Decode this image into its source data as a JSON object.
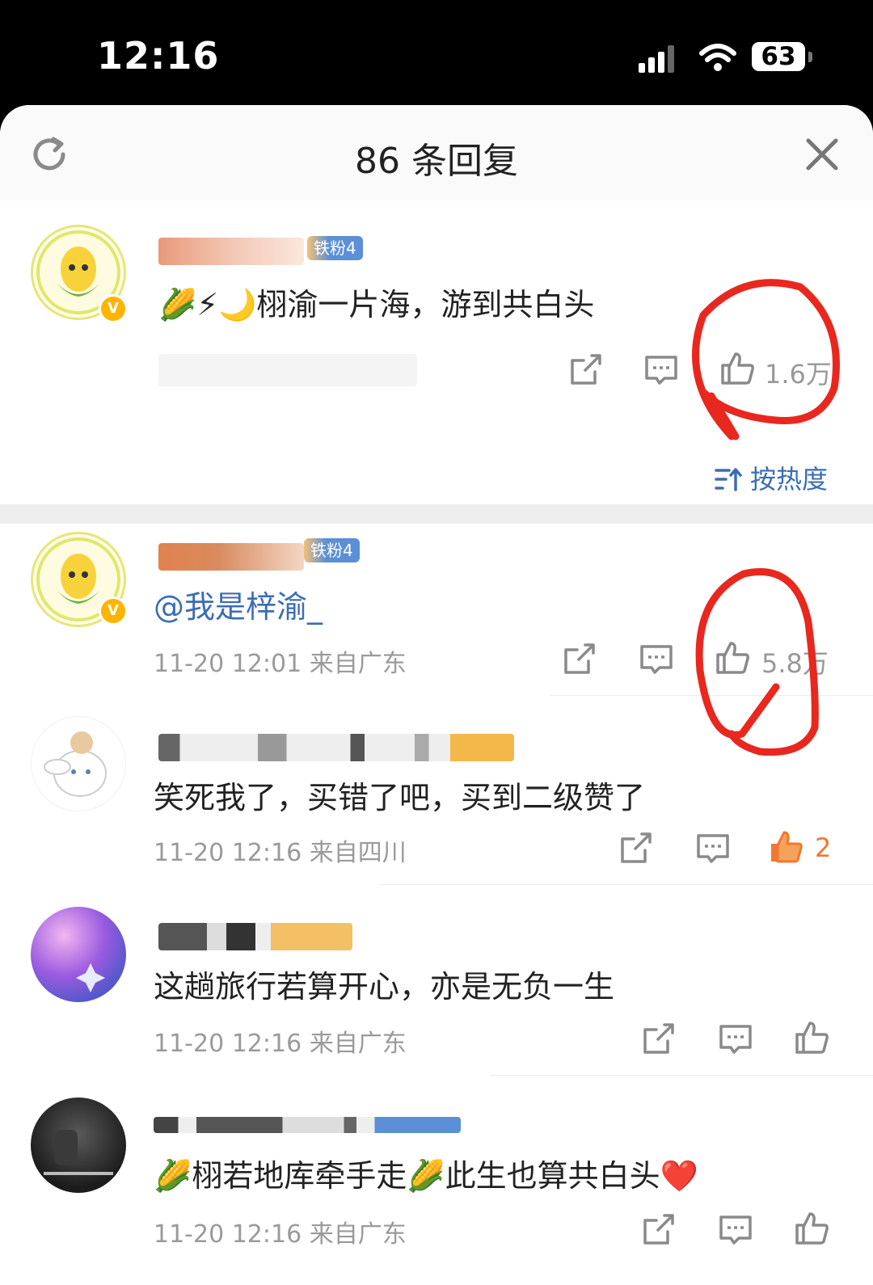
{
  "status_bar": {
    "time": "12:16",
    "battery": "63"
  },
  "header": {
    "title": "86 条回复"
  },
  "root": {
    "badge": "铁粉4",
    "text_emoji": "🌽⚡🌙",
    "text": "栩渝一片海，游到共白头",
    "likes": "1.6万"
  },
  "sort": {
    "label": "按热度"
  },
  "replies": [
    {
      "badge": "铁粉4",
      "text": "@我是梓渝_",
      "meta": "11-20 12:01 来自广东",
      "likes": "5.8万"
    },
    {
      "text": "笑死我了，买错了吧，买到二级赞了",
      "meta": "11-20 12:16 来自四川",
      "likes": "2"
    },
    {
      "text": "这趟旅行若算开心，亦是无负一生",
      "meta": "11-20 12:16 来自广东",
      "likes": ""
    },
    {
      "text": "栩若地库牵手走🌽此生也算共白头",
      "text_prefix": "🌽",
      "text_suffix": "❤️",
      "meta": "11-20 12:16 来自广东",
      "likes": ""
    }
  ],
  "colors": {
    "accent": "#3b6db4",
    "like_active": "#f07830",
    "ink": "#e8281e"
  }
}
